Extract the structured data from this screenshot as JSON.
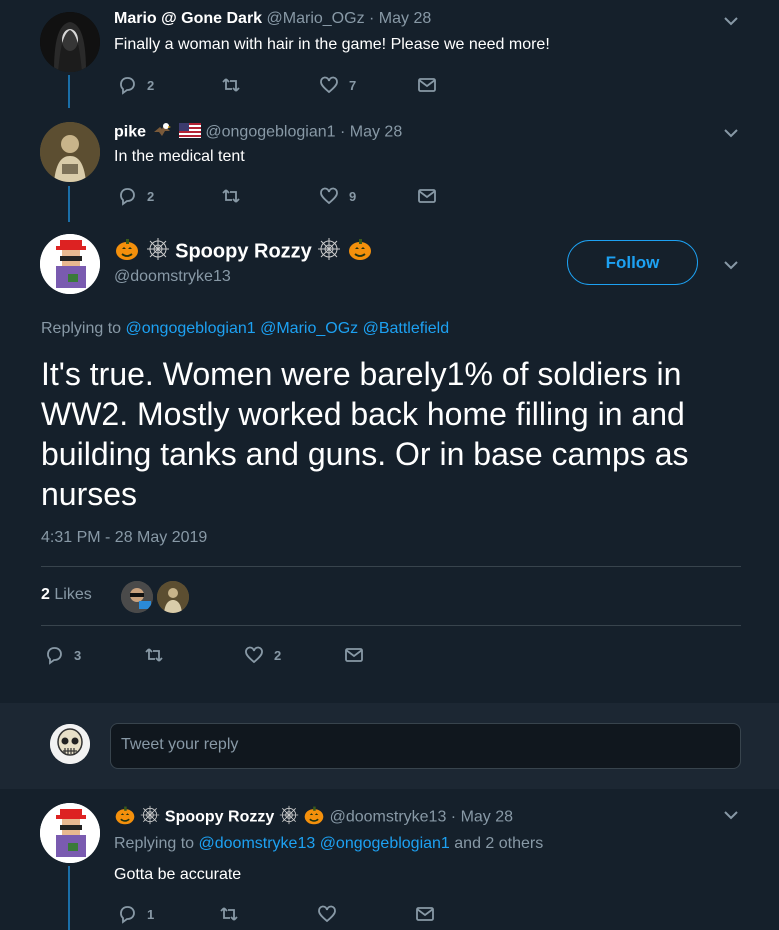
{
  "tweets": [
    {
      "name": "Mario @ Gone Dark",
      "handle": "@Mario_OGz",
      "date": "· May 28",
      "text": "Finally a woman with hair in the game! Please we need more!",
      "replies": "2",
      "likes": "7"
    },
    {
      "name": "pike",
      "handle": "@ongogeblogian1",
      "date": "· May 28",
      "text": "In the medical tent",
      "replies": "2",
      "likes": "9"
    }
  ],
  "main_tweet": {
    "name": "Spoopy Rozzy",
    "handle": "@doomstryke13",
    "follow_label": "Follow",
    "replying_prefix": "Replying to",
    "replying_to": [
      "@ongogeblogian1",
      "@Mario_OGz",
      "@Battlefield"
    ],
    "text": "It's true.  Women were barely1% of soldiers in WW2. Mostly worked back home filling in and building tanks and guns.  Or in base camps as nurses",
    "timestamp": "4:31 PM - 28 May 2019",
    "likes_count": "2",
    "likes_label": "Likes",
    "replies": "3",
    "likes": "2"
  },
  "reply_composer": {
    "placeholder": "Tweet your reply"
  },
  "bottom_tweet": {
    "name": "Spoopy Rozzy",
    "handle": "@doomstryke13",
    "date": "· May 28",
    "replying_prefix": "Replying to",
    "replying_to": [
      "@doomstryke13",
      "@ongogeblogian1"
    ],
    "replying_suffix": "and 2 others",
    "text": "Gotta be accurate",
    "replies": "1"
  },
  "colors": {
    "background": "#15202b",
    "accent": "#1da1f2",
    "muted": "#8899a6",
    "thread_line": "#1a6ea7"
  },
  "icons": [
    "reply-icon",
    "retweet-icon",
    "like-icon",
    "message-icon",
    "chevron-down-icon",
    "pumpkin-icon",
    "spiderweb-icon",
    "eagle-icon",
    "us-flag-icon"
  ]
}
